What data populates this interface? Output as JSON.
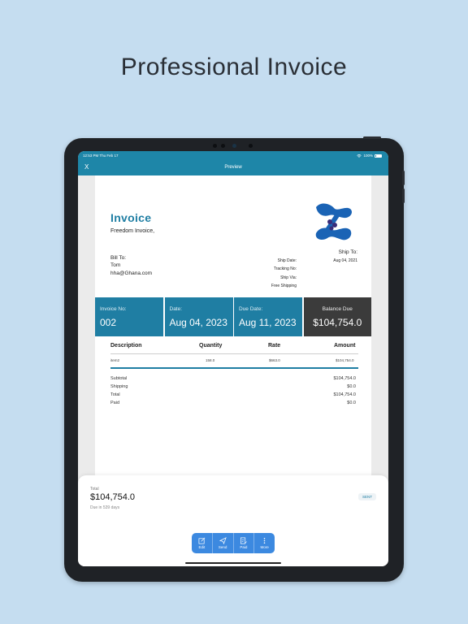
{
  "headline": "Professional Invoice",
  "status_bar": {
    "time": "12:53 PM   Thu Feb 17",
    "battery": "100%"
  },
  "nav": {
    "close": "X",
    "title": "Preview"
  },
  "invoice": {
    "title": "Invoice",
    "company": "Freedom Invoice,",
    "bill_to_label": "Bill To:",
    "bill_name": "Tom",
    "bill_email": "hha@Ghana.com",
    "ship_to_label": "Ship To:",
    "ship_to_date": "Aug 04, 2021",
    "ship_date_label": "Ship Date:",
    "tracking_label": "Tracking No:",
    "ship_via_label": "Ship Via:",
    "shipping_method": "Free Shipping",
    "summary": [
      {
        "label": "Invoice No:",
        "value": "002"
      },
      {
        "label": "Date:",
        "value": "Aug 04, 2023"
      },
      {
        "label": "Due Date:",
        "value": "Aug 11, 2023"
      },
      {
        "label": "Balance Due",
        "value": "$104,754.0"
      }
    ],
    "columns": {
      "description": "Description",
      "quantity": "Quantity",
      "rate": "Rate",
      "amount": "Amount"
    },
    "items": [
      {
        "description": "item2",
        "quantity": "158.0",
        "rate": "$663.0",
        "amount": "$104,754.0"
      }
    ],
    "totals": [
      {
        "label": "Subtotal",
        "value": "$104,754.0"
      },
      {
        "label": "Shipping",
        "value": "$0.0"
      },
      {
        "label": "Total",
        "value": "$104,754.0"
      },
      {
        "label": "Paid",
        "value": "$0.0"
      }
    ]
  },
  "sheet": {
    "total_label": "Total",
    "total": "$104,754.0",
    "due": "Due in 539 days",
    "status": "SENT"
  },
  "actions": [
    {
      "label": "Edit",
      "icon": "edit-icon"
    },
    {
      "label": "Send",
      "icon": "send-icon"
    },
    {
      "label": "Paid",
      "icon": "paid-icon"
    },
    {
      "label": "More",
      "icon": "more-icon"
    }
  ],
  "colors": {
    "accent": "#1f7ea3",
    "background": "#c5ddf0",
    "action_bar": "#3c89e0",
    "balance_cell": "#3b3b3b"
  }
}
